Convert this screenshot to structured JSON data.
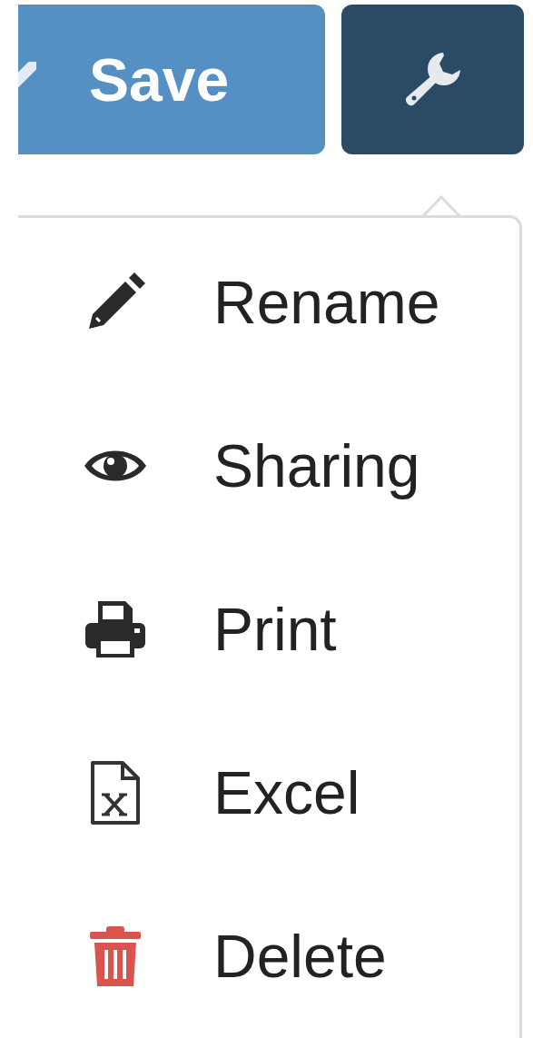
{
  "toolbar": {
    "save_button": {
      "label": "Save"
    }
  },
  "menu": {
    "open": true,
    "items": [
      {
        "kind": "rename",
        "label": "Rename"
      },
      {
        "kind": "share",
        "label": "Sharing"
      },
      {
        "kind": "print",
        "label": "Print"
      },
      {
        "kind": "export",
        "label": "Excel"
      },
      {
        "kind": "delete",
        "label": "Delete"
      }
    ]
  }
}
